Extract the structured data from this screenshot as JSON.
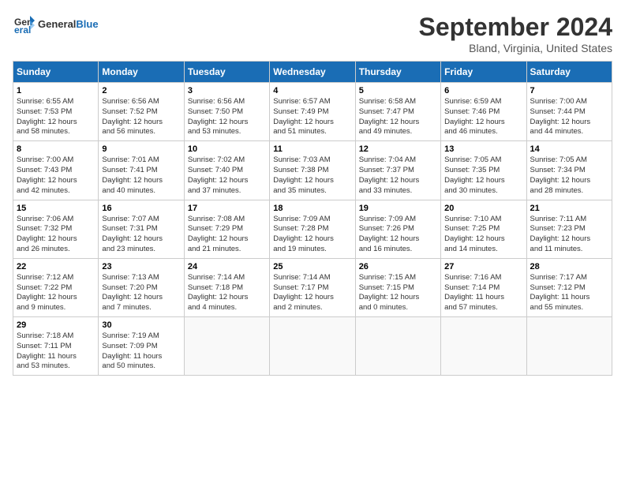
{
  "logo": {
    "general": "General",
    "blue": "Blue"
  },
  "title": "September 2024",
  "subtitle": "Bland, Virginia, United States",
  "days_of_week": [
    "Sunday",
    "Monday",
    "Tuesday",
    "Wednesday",
    "Thursday",
    "Friday",
    "Saturday"
  ],
  "weeks": [
    [
      {
        "day": "1",
        "info": "Sunrise: 6:55 AM\nSunset: 7:53 PM\nDaylight: 12 hours\nand 58 minutes."
      },
      {
        "day": "2",
        "info": "Sunrise: 6:56 AM\nSunset: 7:52 PM\nDaylight: 12 hours\nand 56 minutes."
      },
      {
        "day": "3",
        "info": "Sunrise: 6:56 AM\nSunset: 7:50 PM\nDaylight: 12 hours\nand 53 minutes."
      },
      {
        "day": "4",
        "info": "Sunrise: 6:57 AM\nSunset: 7:49 PM\nDaylight: 12 hours\nand 51 minutes."
      },
      {
        "day": "5",
        "info": "Sunrise: 6:58 AM\nSunset: 7:47 PM\nDaylight: 12 hours\nand 49 minutes."
      },
      {
        "day": "6",
        "info": "Sunrise: 6:59 AM\nSunset: 7:46 PM\nDaylight: 12 hours\nand 46 minutes."
      },
      {
        "day": "7",
        "info": "Sunrise: 7:00 AM\nSunset: 7:44 PM\nDaylight: 12 hours\nand 44 minutes."
      }
    ],
    [
      {
        "day": "8",
        "info": "Sunrise: 7:00 AM\nSunset: 7:43 PM\nDaylight: 12 hours\nand 42 minutes."
      },
      {
        "day": "9",
        "info": "Sunrise: 7:01 AM\nSunset: 7:41 PM\nDaylight: 12 hours\nand 40 minutes."
      },
      {
        "day": "10",
        "info": "Sunrise: 7:02 AM\nSunset: 7:40 PM\nDaylight: 12 hours\nand 37 minutes."
      },
      {
        "day": "11",
        "info": "Sunrise: 7:03 AM\nSunset: 7:38 PM\nDaylight: 12 hours\nand 35 minutes."
      },
      {
        "day": "12",
        "info": "Sunrise: 7:04 AM\nSunset: 7:37 PM\nDaylight: 12 hours\nand 33 minutes."
      },
      {
        "day": "13",
        "info": "Sunrise: 7:05 AM\nSunset: 7:35 PM\nDaylight: 12 hours\nand 30 minutes."
      },
      {
        "day": "14",
        "info": "Sunrise: 7:05 AM\nSunset: 7:34 PM\nDaylight: 12 hours\nand 28 minutes."
      }
    ],
    [
      {
        "day": "15",
        "info": "Sunrise: 7:06 AM\nSunset: 7:32 PM\nDaylight: 12 hours\nand 26 minutes."
      },
      {
        "day": "16",
        "info": "Sunrise: 7:07 AM\nSunset: 7:31 PM\nDaylight: 12 hours\nand 23 minutes."
      },
      {
        "day": "17",
        "info": "Sunrise: 7:08 AM\nSunset: 7:29 PM\nDaylight: 12 hours\nand 21 minutes."
      },
      {
        "day": "18",
        "info": "Sunrise: 7:09 AM\nSunset: 7:28 PM\nDaylight: 12 hours\nand 19 minutes."
      },
      {
        "day": "19",
        "info": "Sunrise: 7:09 AM\nSunset: 7:26 PM\nDaylight: 12 hours\nand 16 minutes."
      },
      {
        "day": "20",
        "info": "Sunrise: 7:10 AM\nSunset: 7:25 PM\nDaylight: 12 hours\nand 14 minutes."
      },
      {
        "day": "21",
        "info": "Sunrise: 7:11 AM\nSunset: 7:23 PM\nDaylight: 12 hours\nand 11 minutes."
      }
    ],
    [
      {
        "day": "22",
        "info": "Sunrise: 7:12 AM\nSunset: 7:22 PM\nDaylight: 12 hours\nand 9 minutes."
      },
      {
        "day": "23",
        "info": "Sunrise: 7:13 AM\nSunset: 7:20 PM\nDaylight: 12 hours\nand 7 minutes."
      },
      {
        "day": "24",
        "info": "Sunrise: 7:14 AM\nSunset: 7:18 PM\nDaylight: 12 hours\nand 4 minutes."
      },
      {
        "day": "25",
        "info": "Sunrise: 7:14 AM\nSunset: 7:17 PM\nDaylight: 12 hours\nand 2 minutes."
      },
      {
        "day": "26",
        "info": "Sunrise: 7:15 AM\nSunset: 7:15 PM\nDaylight: 12 hours\nand 0 minutes."
      },
      {
        "day": "27",
        "info": "Sunrise: 7:16 AM\nSunset: 7:14 PM\nDaylight: 11 hours\nand 57 minutes."
      },
      {
        "day": "28",
        "info": "Sunrise: 7:17 AM\nSunset: 7:12 PM\nDaylight: 11 hours\nand 55 minutes."
      }
    ],
    [
      {
        "day": "29",
        "info": "Sunrise: 7:18 AM\nSunset: 7:11 PM\nDaylight: 11 hours\nand 53 minutes."
      },
      {
        "day": "30",
        "info": "Sunrise: 7:19 AM\nSunset: 7:09 PM\nDaylight: 11 hours\nand 50 minutes."
      },
      {
        "day": "",
        "info": ""
      },
      {
        "day": "",
        "info": ""
      },
      {
        "day": "",
        "info": ""
      },
      {
        "day": "",
        "info": ""
      },
      {
        "day": "",
        "info": ""
      }
    ]
  ]
}
